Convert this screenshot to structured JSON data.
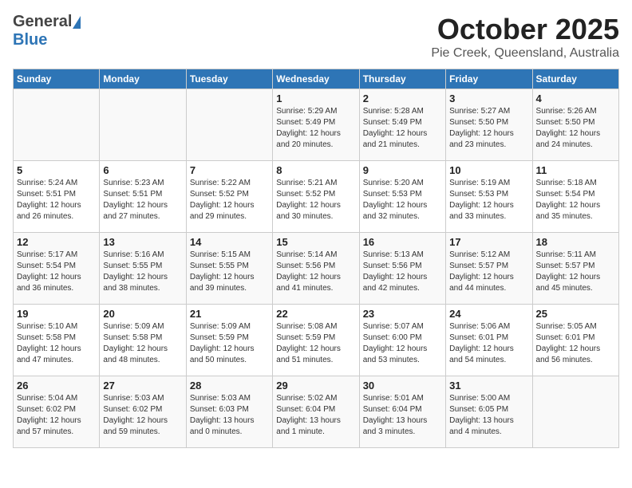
{
  "header": {
    "logo": {
      "general": "General",
      "blue": "Blue"
    },
    "title": "October 2025",
    "location": "Pie Creek, Queensland, Australia"
  },
  "columns": [
    "Sunday",
    "Monday",
    "Tuesday",
    "Wednesday",
    "Thursday",
    "Friday",
    "Saturday"
  ],
  "weeks": [
    [
      {
        "day": "",
        "info": ""
      },
      {
        "day": "",
        "info": ""
      },
      {
        "day": "",
        "info": ""
      },
      {
        "day": "1",
        "info": "Sunrise: 5:29 AM\nSunset: 5:49 PM\nDaylight: 12 hours\nand 20 minutes."
      },
      {
        "day": "2",
        "info": "Sunrise: 5:28 AM\nSunset: 5:49 PM\nDaylight: 12 hours\nand 21 minutes."
      },
      {
        "day": "3",
        "info": "Sunrise: 5:27 AM\nSunset: 5:50 PM\nDaylight: 12 hours\nand 23 minutes."
      },
      {
        "day": "4",
        "info": "Sunrise: 5:26 AM\nSunset: 5:50 PM\nDaylight: 12 hours\nand 24 minutes."
      }
    ],
    [
      {
        "day": "5",
        "info": "Sunrise: 5:24 AM\nSunset: 5:51 PM\nDaylight: 12 hours\nand 26 minutes."
      },
      {
        "day": "6",
        "info": "Sunrise: 5:23 AM\nSunset: 5:51 PM\nDaylight: 12 hours\nand 27 minutes."
      },
      {
        "day": "7",
        "info": "Sunrise: 5:22 AM\nSunset: 5:52 PM\nDaylight: 12 hours\nand 29 minutes."
      },
      {
        "day": "8",
        "info": "Sunrise: 5:21 AM\nSunset: 5:52 PM\nDaylight: 12 hours\nand 30 minutes."
      },
      {
        "day": "9",
        "info": "Sunrise: 5:20 AM\nSunset: 5:53 PM\nDaylight: 12 hours\nand 32 minutes."
      },
      {
        "day": "10",
        "info": "Sunrise: 5:19 AM\nSunset: 5:53 PM\nDaylight: 12 hours\nand 33 minutes."
      },
      {
        "day": "11",
        "info": "Sunrise: 5:18 AM\nSunset: 5:54 PM\nDaylight: 12 hours\nand 35 minutes."
      }
    ],
    [
      {
        "day": "12",
        "info": "Sunrise: 5:17 AM\nSunset: 5:54 PM\nDaylight: 12 hours\nand 36 minutes."
      },
      {
        "day": "13",
        "info": "Sunrise: 5:16 AM\nSunset: 5:55 PM\nDaylight: 12 hours\nand 38 minutes."
      },
      {
        "day": "14",
        "info": "Sunrise: 5:15 AM\nSunset: 5:55 PM\nDaylight: 12 hours\nand 39 minutes."
      },
      {
        "day": "15",
        "info": "Sunrise: 5:14 AM\nSunset: 5:56 PM\nDaylight: 12 hours\nand 41 minutes."
      },
      {
        "day": "16",
        "info": "Sunrise: 5:13 AM\nSunset: 5:56 PM\nDaylight: 12 hours\nand 42 minutes."
      },
      {
        "day": "17",
        "info": "Sunrise: 5:12 AM\nSunset: 5:57 PM\nDaylight: 12 hours\nand 44 minutes."
      },
      {
        "day": "18",
        "info": "Sunrise: 5:11 AM\nSunset: 5:57 PM\nDaylight: 12 hours\nand 45 minutes."
      }
    ],
    [
      {
        "day": "19",
        "info": "Sunrise: 5:10 AM\nSunset: 5:58 PM\nDaylight: 12 hours\nand 47 minutes."
      },
      {
        "day": "20",
        "info": "Sunrise: 5:09 AM\nSunset: 5:58 PM\nDaylight: 12 hours\nand 48 minutes."
      },
      {
        "day": "21",
        "info": "Sunrise: 5:09 AM\nSunset: 5:59 PM\nDaylight: 12 hours\nand 50 minutes."
      },
      {
        "day": "22",
        "info": "Sunrise: 5:08 AM\nSunset: 5:59 PM\nDaylight: 12 hours\nand 51 minutes."
      },
      {
        "day": "23",
        "info": "Sunrise: 5:07 AM\nSunset: 6:00 PM\nDaylight: 12 hours\nand 53 minutes."
      },
      {
        "day": "24",
        "info": "Sunrise: 5:06 AM\nSunset: 6:01 PM\nDaylight: 12 hours\nand 54 minutes."
      },
      {
        "day": "25",
        "info": "Sunrise: 5:05 AM\nSunset: 6:01 PM\nDaylight: 12 hours\nand 56 minutes."
      }
    ],
    [
      {
        "day": "26",
        "info": "Sunrise: 5:04 AM\nSunset: 6:02 PM\nDaylight: 12 hours\nand 57 minutes."
      },
      {
        "day": "27",
        "info": "Sunrise: 5:03 AM\nSunset: 6:02 PM\nDaylight: 12 hours\nand 59 minutes."
      },
      {
        "day": "28",
        "info": "Sunrise: 5:03 AM\nSunset: 6:03 PM\nDaylight: 13 hours\nand 0 minutes."
      },
      {
        "day": "29",
        "info": "Sunrise: 5:02 AM\nSunset: 6:04 PM\nDaylight: 13 hours\nand 1 minute."
      },
      {
        "day": "30",
        "info": "Sunrise: 5:01 AM\nSunset: 6:04 PM\nDaylight: 13 hours\nand 3 minutes."
      },
      {
        "day": "31",
        "info": "Sunrise: 5:00 AM\nSunset: 6:05 PM\nDaylight: 13 hours\nand 4 minutes."
      },
      {
        "day": "",
        "info": ""
      }
    ]
  ]
}
